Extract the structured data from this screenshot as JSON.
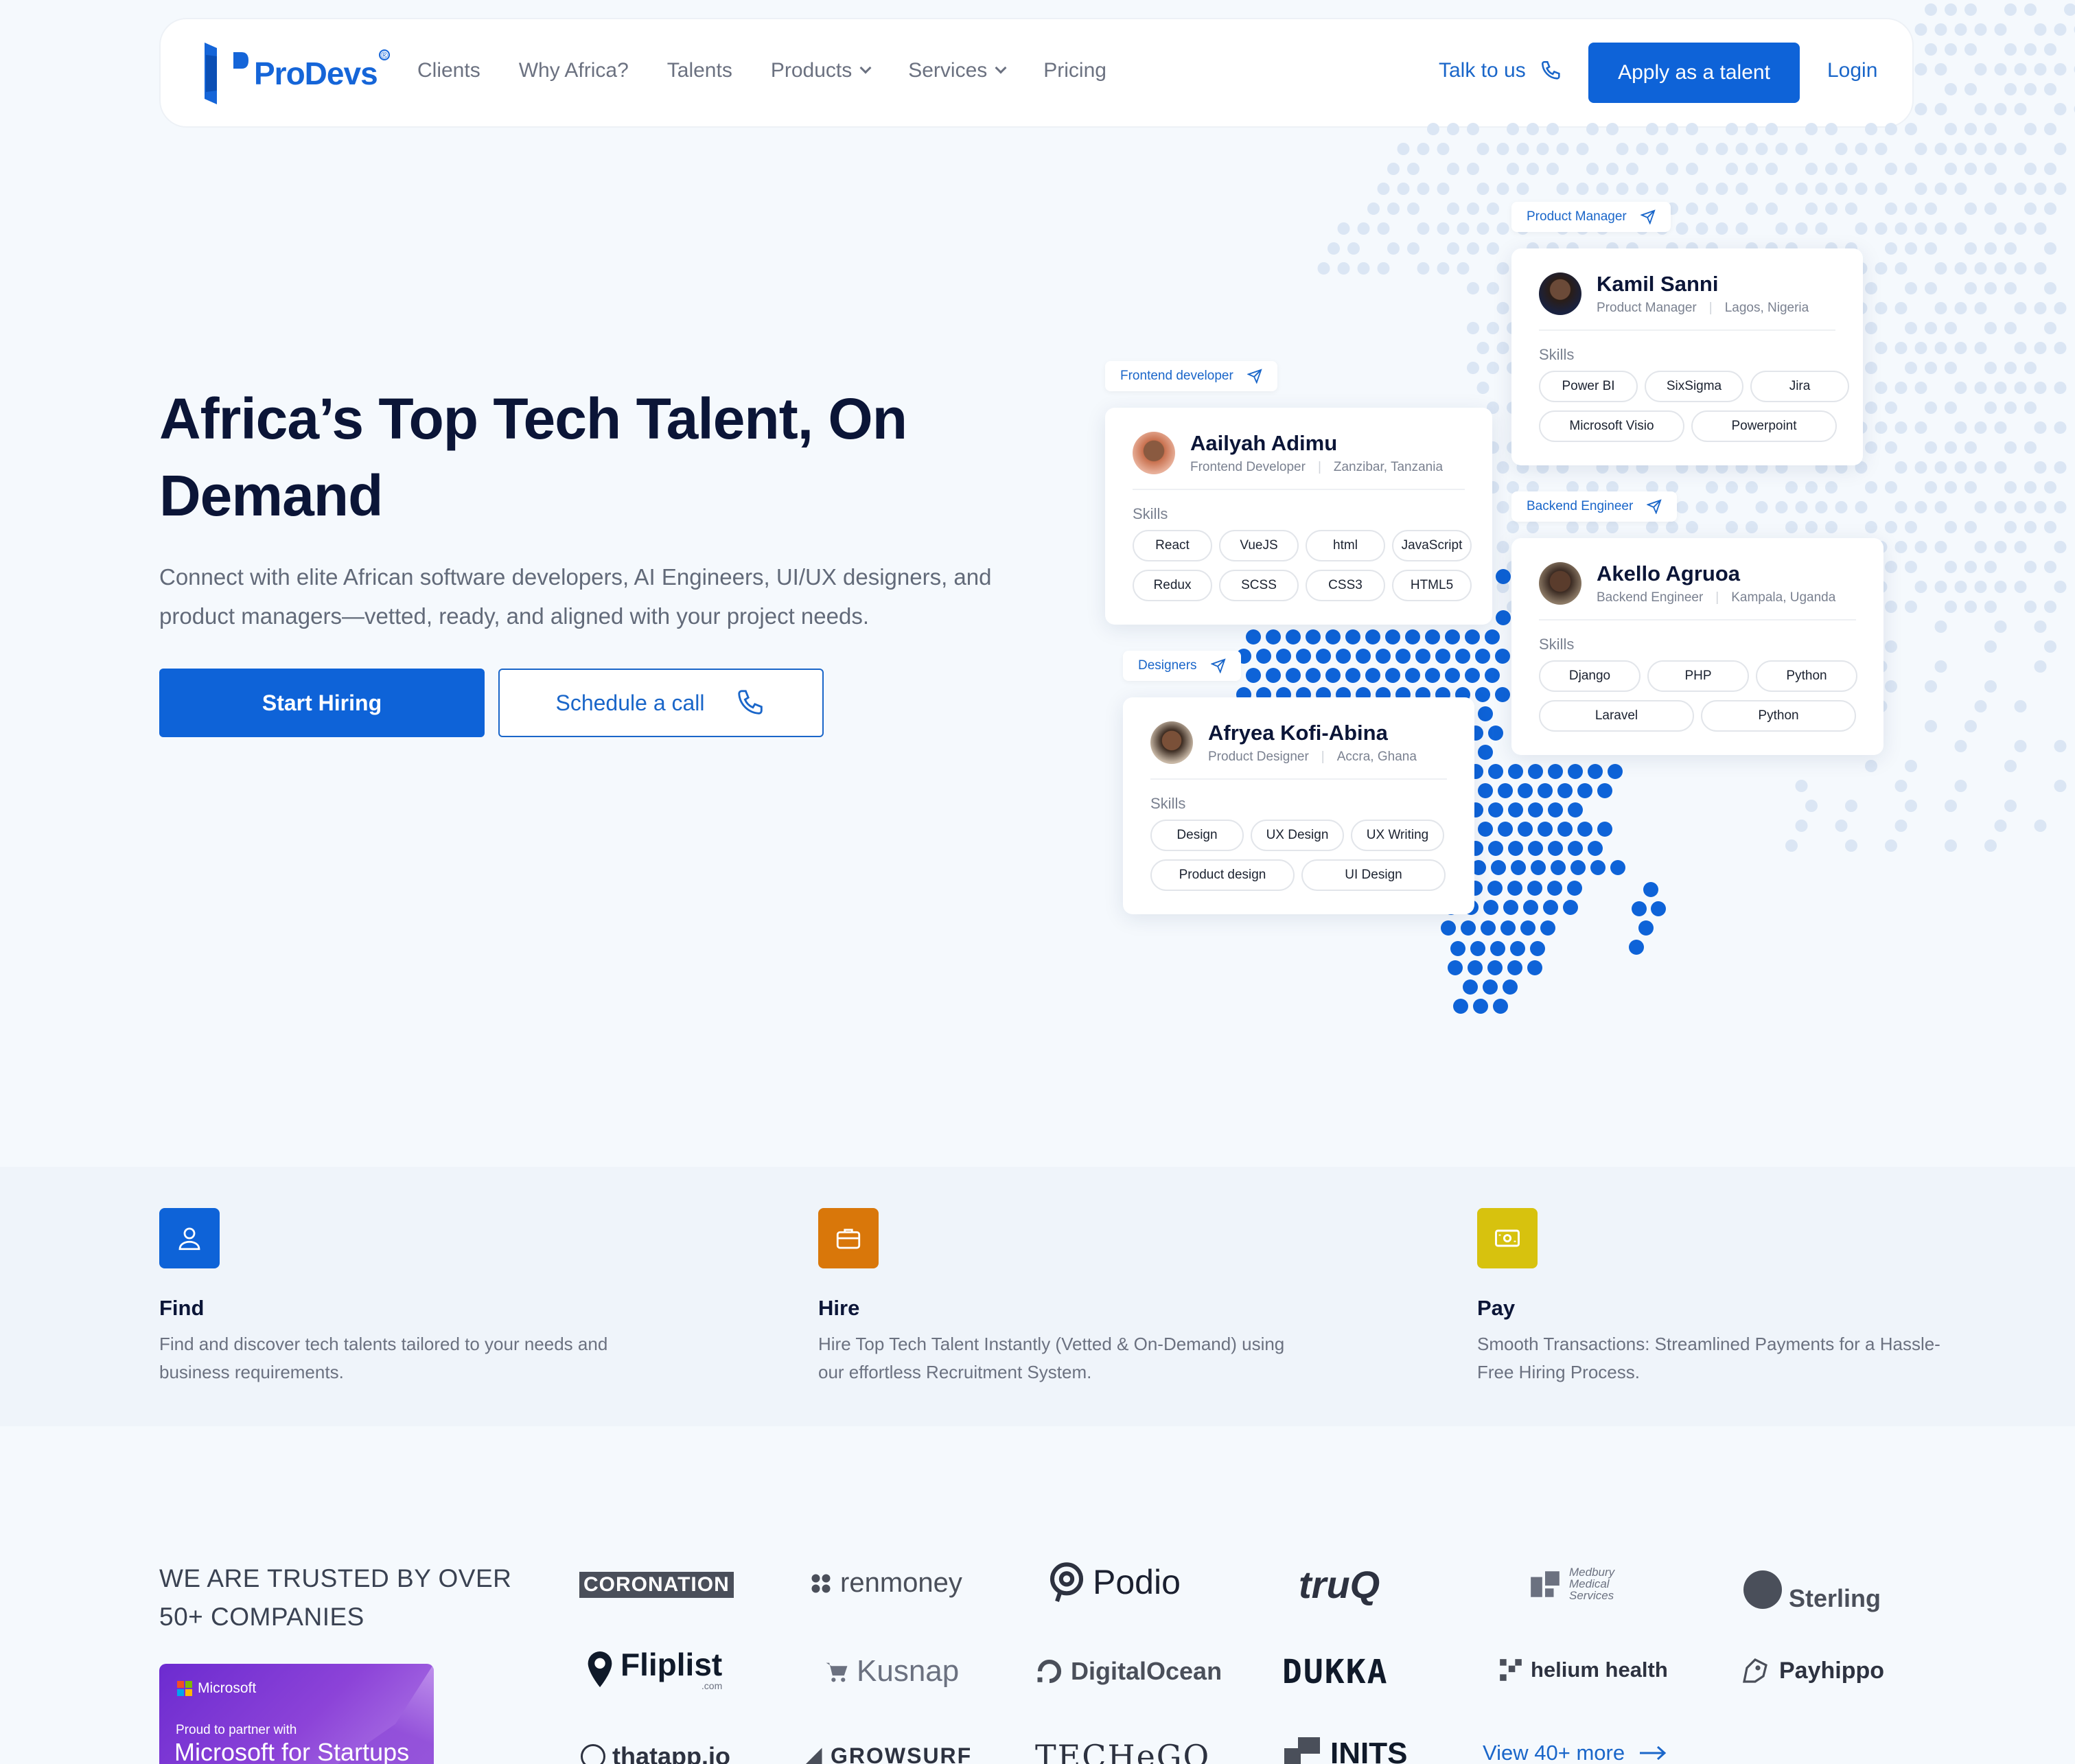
{
  "nav": {
    "brand": "ProDevs",
    "links": [
      {
        "label": "Clients",
        "dropdown": false
      },
      {
        "label": "Why Africa?",
        "dropdown": false
      },
      {
        "label": "Talents",
        "dropdown": false
      },
      {
        "label": "Products",
        "dropdown": true
      },
      {
        "label": "Services",
        "dropdown": true
      },
      {
        "label": "Pricing",
        "dropdown": false
      }
    ],
    "talk_label": "Talk to us",
    "apply_label": "Apply as a talent",
    "login_label": "Login"
  },
  "hero": {
    "title": "Africa’s Top Tech Talent, On Demand",
    "subtitle": "Connect with elite African software developers, AI Engineers, UI/UX designers, and product managers—vetted, ready, and aligned with your project needs.",
    "start_label": "Start Hiring",
    "call_label": "Schedule a call"
  },
  "skills_label": "Skills",
  "talents": [
    {
      "tag": "Product Manager",
      "name": "Kamil Sanni",
      "role": "Product Manager",
      "location": "Lagos, Nigeria",
      "skills": [
        "Power BI",
        "SixSigma",
        "Jira",
        "Microsoft Visio",
        "Powerpoint"
      ]
    },
    {
      "tag": "Frontend developer",
      "name": "Aailyah Adimu",
      "role": "Frontend Developer",
      "location": "Zanzibar, Tanzania",
      "skills": [
        "React",
        "VueJS",
        "html",
        "JavaScript",
        "Redux",
        "SCSS",
        "CSS3",
        "HTML5"
      ]
    },
    {
      "tag": "Backend Engineer",
      "name": "Akello Agruoa",
      "role": "Backend Engineer",
      "location": "Kampala, Uganda",
      "skills": [
        "Django",
        "PHP",
        "Python",
        "Laravel",
        "Python"
      ]
    },
    {
      "tag": "Designers",
      "name": "Afryea Kofi-Abina",
      "role": "Product Designer",
      "location": "Accra, Ghana",
      "skills": [
        "Design",
        "UX Design",
        "UX Writing",
        "Product design",
        "UI Design"
      ]
    }
  ],
  "features": [
    {
      "title": "Find",
      "desc": "Find and discover tech talents tailored to your needs and business requirements.",
      "icon": "user-icon",
      "color": "#0e63d8"
    },
    {
      "title": "Hire",
      "desc": "Hire Top Tech Talent Instantly (Vetted & On-Demand) using our effortless Recruitment System.",
      "icon": "briefcase-icon",
      "color": "#d9770a"
    },
    {
      "title": "Pay",
      "desc": "Smooth Transactions: Streamlined Payments for a Hassle-Free Hiring Process.",
      "icon": "cash-icon",
      "color": "#d7c20e"
    }
  ],
  "trusted": {
    "heading": "WE ARE TRUSTED BY OVER 50+ COMPANIES",
    "ms_brand": "Microsoft",
    "ms_proud": "Proud to partner with",
    "ms_program": "Microsoft for Startups",
    "logos": [
      "CORONATION",
      "renmoney",
      "Podio",
      "truQ",
      "Medbury Medical Services",
      "Sterling",
      "Fliplist",
      ".com",
      "Kusnap",
      "DigitalOcean",
      "DUKKA",
      "helium health",
      "Payhippo",
      "thatapp.io",
      "GROWSURF",
      "TECHeGO",
      "INITS"
    ],
    "view_more": "View 40+ more"
  },
  "colors": {
    "primary": "#0e63d8",
    "dot": "#0e63d8",
    "dot_faint": "#dbe6f4"
  }
}
